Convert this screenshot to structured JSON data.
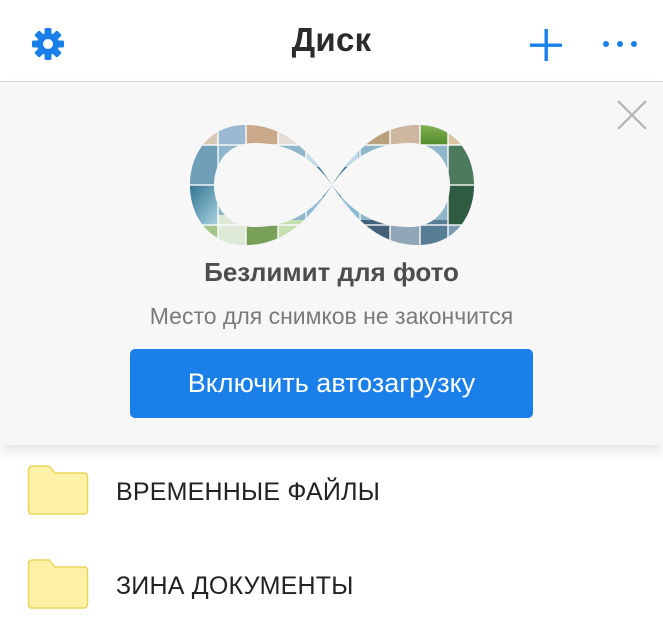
{
  "header": {
    "title": "Диск",
    "icons": {
      "settings": "gear-icon",
      "add": "plus-icon",
      "more": "more-horizontal-icon"
    },
    "accent_color": "#1a7fe8"
  },
  "promo": {
    "title": "Безлимит для фото",
    "subtitle": "Место для снимков не закончится",
    "button_label": "Включить автозагрузку",
    "button_color": "#1a7fe8",
    "close_icon": "close-icon",
    "illustration": "infinity-photo-collage"
  },
  "files": [
    {
      "name": "ВРЕМЕННЫЕ ФАЙЛЫ",
      "icon": "folder-icon",
      "color": "#fdf0a7"
    },
    {
      "name": "ЗИНА ДОКУМЕНТЫ",
      "icon": "folder-icon",
      "color": "#fdf0a7"
    }
  ]
}
